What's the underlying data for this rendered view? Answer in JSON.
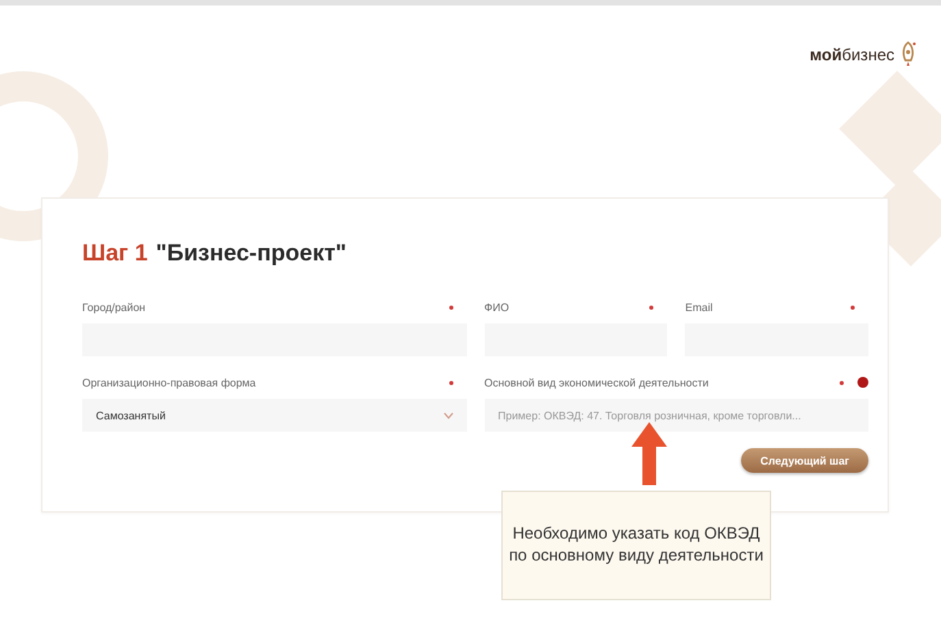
{
  "logo": {
    "text": "**мой**бизнес"
  },
  "form": {
    "step": "Шаг 1",
    "title": "\"Бизнес-проект\"",
    "rows": [
      [
        {
          "kind": "text",
          "label": "Город/район",
          "required": true,
          "info": false
        },
        {
          "kind": "text",
          "label": "ФИО",
          "required": true,
          "info": false
        },
        {
          "kind": "text",
          "label": "Email",
          "required": true,
          "info": false
        }
      ],
      [
        {
          "kind": "select",
          "label": "Организационно-правовая форма",
          "required": true,
          "info": false,
          "value": "Самозанятый"
        },
        {
          "kind": "text",
          "label": "Основной вид экономической деятельности",
          "required": true,
          "info": true,
          "placeholder": "Пример: ОКВЭД: 47. Торговля розничная, кроме торговли..."
        }
      ]
    ],
    "next_button": "Следующий шаг"
  },
  "callout": {
    "text": "Необходимо указать код ОКВЭД\nпо основному виду деятельности"
  }
}
